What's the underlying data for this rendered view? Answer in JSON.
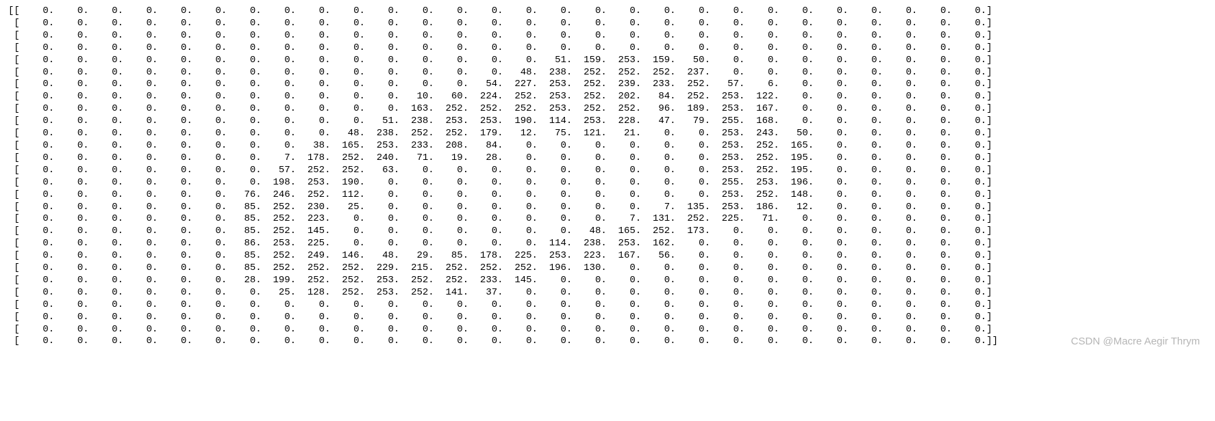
{
  "watermark": "CSDN @Macre Aegir Thrym",
  "chart_data": {
    "type": "table",
    "title": "",
    "rows": 28,
    "cols": 28,
    "matrix": [
      [
        0,
        0,
        0,
        0,
        0,
        0,
        0,
        0,
        0,
        0,
        0,
        0,
        0,
        0,
        0,
        0,
        0,
        0,
        0,
        0,
        0,
        0,
        0,
        0,
        0,
        0,
        0,
        0
      ],
      [
        0,
        0,
        0,
        0,
        0,
        0,
        0,
        0,
        0,
        0,
        0,
        0,
        0,
        0,
        0,
        0,
        0,
        0,
        0,
        0,
        0,
        0,
        0,
        0,
        0,
        0,
        0,
        0
      ],
      [
        0,
        0,
        0,
        0,
        0,
        0,
        0,
        0,
        0,
        0,
        0,
        0,
        0,
        0,
        0,
        0,
        0,
        0,
        0,
        0,
        0,
        0,
        0,
        0,
        0,
        0,
        0,
        0
      ],
      [
        0,
        0,
        0,
        0,
        0,
        0,
        0,
        0,
        0,
        0,
        0,
        0,
        0,
        0,
        0,
        0,
        0,
        0,
        0,
        0,
        0,
        0,
        0,
        0,
        0,
        0,
        0,
        0
      ],
      [
        0,
        0,
        0,
        0,
        0,
        0,
        0,
        0,
        0,
        0,
        0,
        0,
        0,
        0,
        0,
        51,
        159,
        253,
        159,
        50,
        0,
        0,
        0,
        0,
        0,
        0,
        0,
        0
      ],
      [
        0,
        0,
        0,
        0,
        0,
        0,
        0,
        0,
        0,
        0,
        0,
        0,
        0,
        0,
        48,
        238,
        252,
        252,
        252,
        237,
        0,
        0,
        0,
        0,
        0,
        0,
        0,
        0
      ],
      [
        0,
        0,
        0,
        0,
        0,
        0,
        0,
        0,
        0,
        0,
        0,
        0,
        0,
        54,
        227,
        253,
        252,
        239,
        233,
        252,
        57,
        6,
        0,
        0,
        0,
        0,
        0,
        0
      ],
      [
        0,
        0,
        0,
        0,
        0,
        0,
        0,
        0,
        0,
        0,
        0,
        10,
        60,
        224,
        252,
        253,
        252,
        202,
        84,
        252,
        253,
        122,
        0,
        0,
        0,
        0,
        0,
        0
      ],
      [
        0,
        0,
        0,
        0,
        0,
        0,
        0,
        0,
        0,
        0,
        0,
        163,
        252,
        252,
        252,
        253,
        252,
        252,
        96,
        189,
        253,
        167,
        0,
        0,
        0,
        0,
        0,
        0
      ],
      [
        0,
        0,
        0,
        0,
        0,
        0,
        0,
        0,
        0,
        0,
        51,
        238,
        253,
        253,
        190,
        114,
        253,
        228,
        47,
        79,
        255,
        168,
        0,
        0,
        0,
        0,
        0,
        0
      ],
      [
        0,
        0,
        0,
        0,
        0,
        0,
        0,
        0,
        0,
        48,
        238,
        252,
        252,
        179,
        12,
        75,
        121,
        21,
        0,
        0,
        253,
        243,
        50,
        0,
        0,
        0,
        0,
        0
      ],
      [
        0,
        0,
        0,
        0,
        0,
        0,
        0,
        0,
        38,
        165,
        253,
        233,
        208,
        84,
        0,
        0,
        0,
        0,
        0,
        0,
        253,
        252,
        165,
        0,
        0,
        0,
        0,
        0
      ],
      [
        0,
        0,
        0,
        0,
        0,
        0,
        0,
        7,
        178,
        252,
        240,
        71,
        19,
        28,
        0,
        0,
        0,
        0,
        0,
        0,
        253,
        252,
        195,
        0,
        0,
        0,
        0,
        0
      ],
      [
        0,
        0,
        0,
        0,
        0,
        0,
        0,
        57,
        252,
        252,
        63,
        0,
        0,
        0,
        0,
        0,
        0,
        0,
        0,
        0,
        253,
        252,
        195,
        0,
        0,
        0,
        0,
        0
      ],
      [
        0,
        0,
        0,
        0,
        0,
        0,
        0,
        198,
        253,
        190,
        0,
        0,
        0,
        0,
        0,
        0,
        0,
        0,
        0,
        0,
        255,
        253,
        196,
        0,
        0,
        0,
        0,
        0
      ],
      [
        0,
        0,
        0,
        0,
        0,
        0,
        76,
        246,
        252,
        112,
        0,
        0,
        0,
        0,
        0,
        0,
        0,
        0,
        0,
        0,
        253,
        252,
        148,
        0,
        0,
        0,
        0,
        0
      ],
      [
        0,
        0,
        0,
        0,
        0,
        0,
        85,
        252,
        230,
        25,
        0,
        0,
        0,
        0,
        0,
        0,
        0,
        0,
        7,
        135,
        253,
        186,
        12,
        0,
        0,
        0,
        0,
        0
      ],
      [
        0,
        0,
        0,
        0,
        0,
        0,
        85,
        252,
        223,
        0,
        0,
        0,
        0,
        0,
        0,
        0,
        0,
        7,
        131,
        252,
        225,
        71,
        0,
        0,
        0,
        0,
        0,
        0
      ],
      [
        0,
        0,
        0,
        0,
        0,
        0,
        85,
        252,
        145,
        0,
        0,
        0,
        0,
        0,
        0,
        0,
        48,
        165,
        252,
        173,
        0,
        0,
        0,
        0,
        0,
        0,
        0,
        0
      ],
      [
        0,
        0,
        0,
        0,
        0,
        0,
        86,
        253,
        225,
        0,
        0,
        0,
        0,
        0,
        0,
        114,
        238,
        253,
        162,
        0,
        0,
        0,
        0,
        0,
        0,
        0,
        0,
        0
      ],
      [
        0,
        0,
        0,
        0,
        0,
        0,
        85,
        252,
        249,
        146,
        48,
        29,
        85,
        178,
        225,
        253,
        223,
        167,
        56,
        0,
        0,
        0,
        0,
        0,
        0,
        0,
        0,
        0
      ],
      [
        0,
        0,
        0,
        0,
        0,
        0,
        85,
        252,
        252,
        252,
        229,
        215,
        252,
        252,
        252,
        196,
        130,
        0,
        0,
        0,
        0,
        0,
        0,
        0,
        0,
        0,
        0,
        0
      ],
      [
        0,
        0,
        0,
        0,
        0,
        0,
        28,
        199,
        252,
        252,
        253,
        252,
        252,
        233,
        145,
        0,
        0,
        0,
        0,
        0,
        0,
        0,
        0,
        0,
        0,
        0,
        0,
        0
      ],
      [
        0,
        0,
        0,
        0,
        0,
        0,
        0,
        25,
        128,
        252,
        253,
        252,
        141,
        37,
        0,
        0,
        0,
        0,
        0,
        0,
        0,
        0,
        0,
        0,
        0,
        0,
        0,
        0
      ],
      [
        0,
        0,
        0,
        0,
        0,
        0,
        0,
        0,
        0,
        0,
        0,
        0,
        0,
        0,
        0,
        0,
        0,
        0,
        0,
        0,
        0,
        0,
        0,
        0,
        0,
        0,
        0,
        0
      ],
      [
        0,
        0,
        0,
        0,
        0,
        0,
        0,
        0,
        0,
        0,
        0,
        0,
        0,
        0,
        0,
        0,
        0,
        0,
        0,
        0,
        0,
        0,
        0,
        0,
        0,
        0,
        0,
        0
      ],
      [
        0,
        0,
        0,
        0,
        0,
        0,
        0,
        0,
        0,
        0,
        0,
        0,
        0,
        0,
        0,
        0,
        0,
        0,
        0,
        0,
        0,
        0,
        0,
        0,
        0,
        0,
        0,
        0
      ],
      [
        0,
        0,
        0,
        0,
        0,
        0,
        0,
        0,
        0,
        0,
        0,
        0,
        0,
        0,
        0,
        0,
        0,
        0,
        0,
        0,
        0,
        0,
        0,
        0,
        0,
        0,
        0,
        0
      ]
    ]
  }
}
